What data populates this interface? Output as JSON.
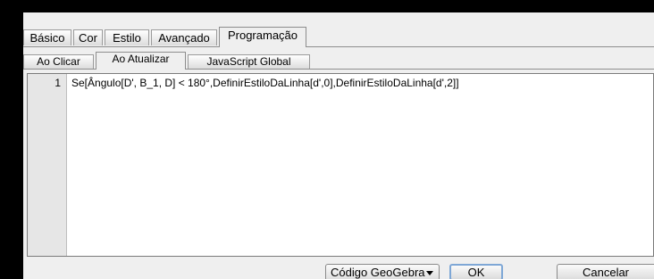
{
  "top_tabs": [
    {
      "label": "Básico"
    },
    {
      "label": "Cor"
    },
    {
      "label": "Estilo"
    },
    {
      "label": "Avançado"
    },
    {
      "label": "Programação",
      "active": true
    }
  ],
  "sub_tabs": [
    {
      "label": "Ao Clicar"
    },
    {
      "label": "Ao Atualizar",
      "active": true
    },
    {
      "label": "JavaScript Global"
    }
  ],
  "editor": {
    "line_number": "1",
    "code": "Se[Ângulo[D', B_1, D] < 180°,DefinirEstiloDaLinha[d',0],DefinirEstiloDaLinha[d',2]]"
  },
  "footer": {
    "script_type": "Código GeoGebra",
    "ok_label": "OK",
    "cancel_label": "Cancelar"
  },
  "colors": {
    "panel_bg": "#efefef",
    "ok_border": "#7ea7d6"
  }
}
